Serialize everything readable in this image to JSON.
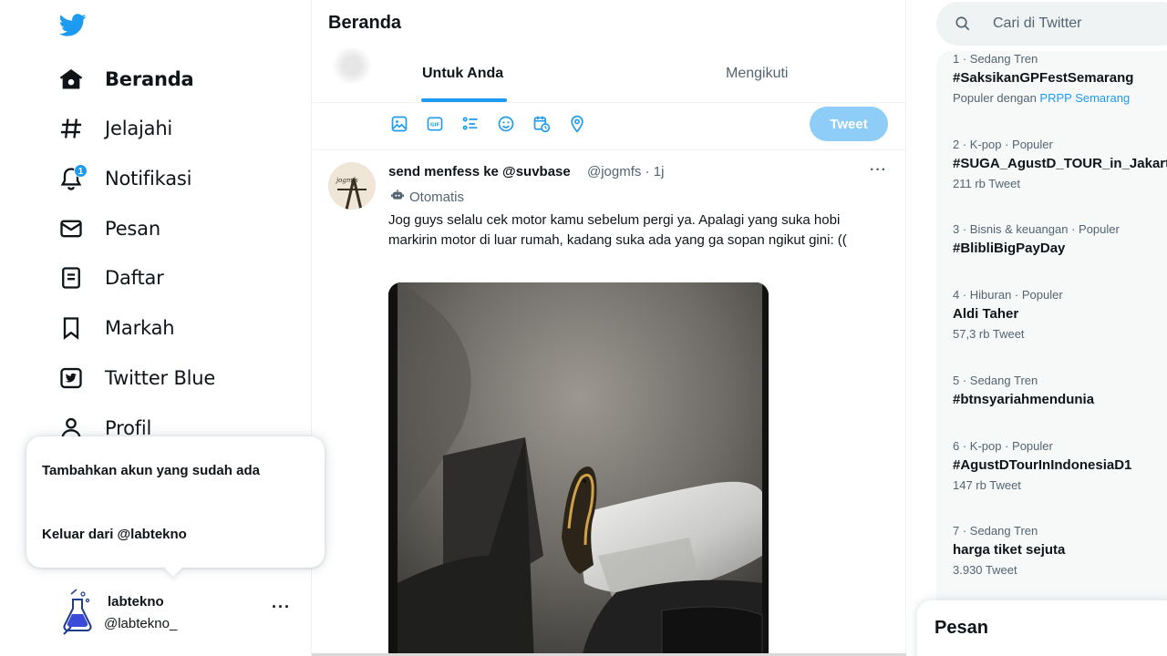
{
  "brand": {
    "logo_icon": "twitter-bird-icon",
    "color": "#1d9bf0"
  },
  "nav": [
    {
      "label": "Beranda",
      "icon": "home-icon",
      "active": true
    },
    {
      "label": "Jelajahi",
      "icon": "hashtag-icon"
    },
    {
      "label": "Notifikasi",
      "icon": "bell-icon",
      "badge": "1"
    },
    {
      "label": "Pesan",
      "icon": "envelope-icon"
    },
    {
      "label": "Daftar",
      "icon": "list-icon"
    },
    {
      "label": "Markah",
      "icon": "bookmark-icon"
    },
    {
      "label": "Twitter Blue",
      "icon": "twitter-blue-icon"
    },
    {
      "label": "Profil",
      "icon": "profile-icon"
    }
  ],
  "account_popup": {
    "add_existing": "Tambahkan akun yang sudah ada",
    "logout": "Keluar dari @labtekno"
  },
  "account": {
    "name": "labtekno",
    "handle": "@labtekno_",
    "more": "···"
  },
  "main": {
    "title": "Beranda",
    "tabs": [
      "Untuk Anda",
      "Mengikuti"
    ],
    "composer_tools": [
      "image-icon",
      "gif-icon",
      "poll-icon",
      "emoji-icon",
      "schedule-icon",
      "location-icon"
    ],
    "tweet_button": "Tweet"
  },
  "tweet": {
    "author_name": "send menfess ke @suvbase",
    "handle_time": "@jogmfs · 1j",
    "automated": "Otomatis",
    "text": "Jog guys selalu cek motor kamu sebelum pergi ya. Apalagi yang suka hobi markirin motor di luar rumah, kadang suka ada yang ga sopan ngikut gini: ((",
    "more": "···"
  },
  "search": {
    "placeholder": "Cari di Twitter"
  },
  "trends": [
    {
      "meta": "1 · Sedang Tren",
      "name": "#SaksikanGPFestSemarang",
      "sub_prefix": "Populer dengan ",
      "sub_link": "PRPP Semarang"
    },
    {
      "meta": "2 · K-pop · Populer",
      "name": "#SUGA_AgustD_TOUR_in_Jakarta",
      "count": "211 rb Tweet"
    },
    {
      "meta": "3 · Bisnis & keuangan · Populer",
      "name": "#BlibliBigPayDay"
    },
    {
      "meta": "4 · Hiburan · Populer",
      "name": "Aldi Taher",
      "count": "57,3 rb Tweet"
    },
    {
      "meta": "5 · Sedang Tren",
      "name": "#btnsyariahmendunia"
    },
    {
      "meta": "6 · K-pop · Populer",
      "name": "#AgustDTourInIndonesiaD1",
      "count": "147 rb Tweet"
    },
    {
      "meta": "7 · Sedang Tren",
      "name": "harga tiket sejuta",
      "count": "3.930 Tweet"
    }
  ],
  "messages": {
    "title": "Pesan"
  }
}
